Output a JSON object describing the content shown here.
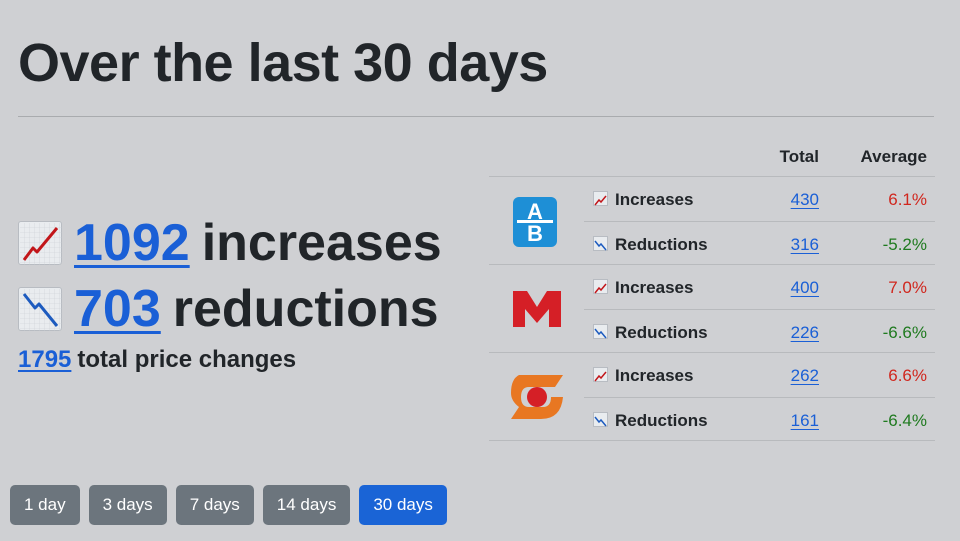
{
  "title": "Over the last 30 days",
  "summary": {
    "increases_count": "1092",
    "increases_word": "increases",
    "reductions_count": "703",
    "reductions_word": "reductions",
    "total_count": "1795",
    "total_text": "total price changes"
  },
  "table": {
    "header_total": "Total",
    "header_average": "Average",
    "stores": [
      {
        "logo": "ab-logo",
        "rows": [
          {
            "icon": "increase-chart-icon",
            "label": "Increases",
            "total": "430",
            "average": "6.1%"
          },
          {
            "icon": "decrease-chart-icon",
            "label": "Reductions",
            "total": "316",
            "average": "-5.2%"
          }
        ]
      },
      {
        "logo": "masoutis-logo",
        "rows": [
          {
            "icon": "increase-chart-icon",
            "label": "Increases",
            "total": "400",
            "average": "7.0%"
          },
          {
            "icon": "decrease-chart-icon",
            "label": "Reductions",
            "total": "226",
            "average": "-6.6%"
          }
        ]
      },
      {
        "logo": "sklavenitis-logo",
        "rows": [
          {
            "icon": "increase-chart-icon",
            "label": "Increases",
            "total": "262",
            "average": "6.6%"
          },
          {
            "icon": "decrease-chart-icon",
            "label": "Reductions",
            "total": "161",
            "average": "-6.4%"
          }
        ]
      }
    ]
  },
  "range_buttons": [
    {
      "label": "1 day",
      "active": false
    },
    {
      "label": "3 days",
      "active": false
    },
    {
      "label": "7 days",
      "active": false
    },
    {
      "label": "14 days",
      "active": false
    },
    {
      "label": "30 days",
      "active": true
    }
  ],
  "colors": {
    "link": "#1a5fd6",
    "positive": "#d0271e",
    "negative": "#1f7a1f",
    "button_default": "#6c757d",
    "button_active": "#1a64d6"
  }
}
